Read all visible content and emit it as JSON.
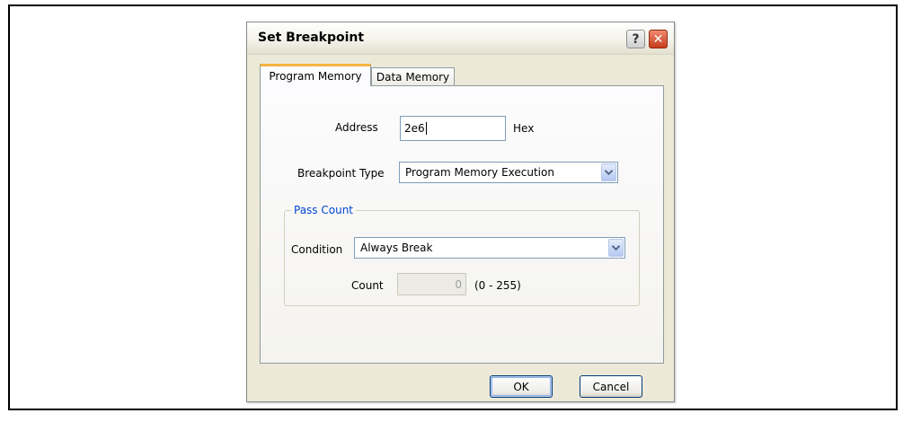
{
  "dialog": {
    "title": "Set Breakpoint",
    "help_label": "?",
    "close_label": "✕"
  },
  "tabs": [
    {
      "label": "Program Memory",
      "active": true
    },
    {
      "label": "Data Memory",
      "active": false
    }
  ],
  "form": {
    "address_label": "Address",
    "address_value": "2e6",
    "address_unit": "Hex",
    "breakpoint_type_label": "Breakpoint Type",
    "breakpoint_type_value": "Program Memory Execution"
  },
  "pass_count": {
    "legend": "Pass Count",
    "condition_label": "Condition",
    "condition_value": "Always Break",
    "count_label": "Count",
    "count_value": "0",
    "count_range": "(0 - 255)"
  },
  "buttons": {
    "ok": "OK",
    "cancel": "Cancel"
  },
  "icons": {
    "dropdown": "chevron-down-icon",
    "help": "question-icon",
    "close": "close-icon"
  },
  "colors": {
    "dialog_bg": "#ece9d8",
    "accent_tab": "#f5b440",
    "legend": "#0046d5",
    "close_button": "#c63d1d"
  }
}
